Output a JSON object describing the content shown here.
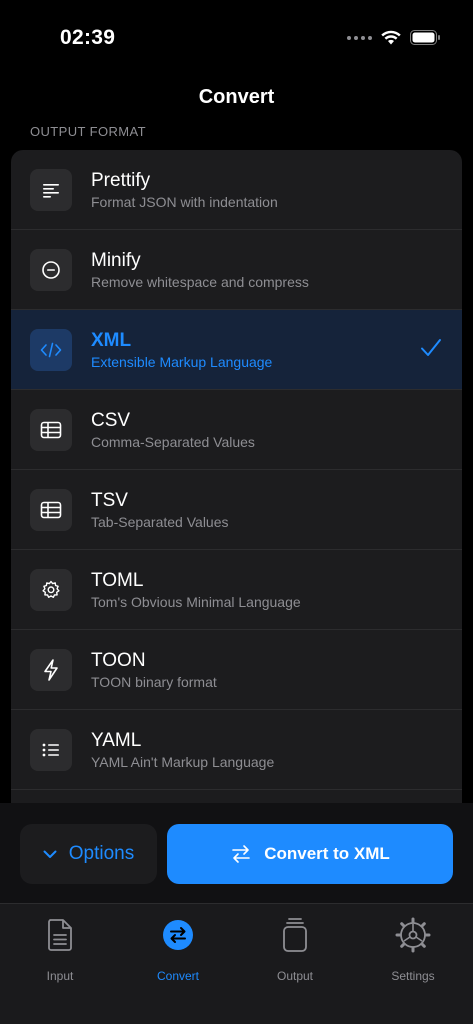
{
  "status_bar": {
    "time": "02:39"
  },
  "nav": {
    "title": "Convert"
  },
  "section": {
    "header": "OUTPUT FORMAT"
  },
  "formats": [
    {
      "title": "Prettify",
      "subtitle": "Format JSON with indentation",
      "icon": "text-align-left-icon",
      "selected": false
    },
    {
      "title": "Minify",
      "subtitle": "Remove whitespace and compress",
      "icon": "minus-circle-icon",
      "selected": false
    },
    {
      "title": "XML",
      "subtitle": "Extensible Markup Language",
      "icon": "code-brackets-icon",
      "selected": true
    },
    {
      "title": "CSV",
      "subtitle": "Comma-Separated Values",
      "icon": "table-icon",
      "selected": false
    },
    {
      "title": "TSV",
      "subtitle": "Tab-Separated Values",
      "icon": "table-icon",
      "selected": false
    },
    {
      "title": "TOML",
      "subtitle": "Tom's Obvious Minimal Language",
      "icon": "gear-icon",
      "selected": false
    },
    {
      "title": "TOON",
      "subtitle": "TOON binary format",
      "icon": "lightning-icon",
      "selected": false
    },
    {
      "title": "YAML",
      "subtitle": "YAML Ain't Markup Language",
      "icon": "list-icon",
      "selected": false
    }
  ],
  "actions": {
    "options_label": "Options",
    "convert_label": "Convert to XML"
  },
  "tabs": [
    {
      "label": "Input",
      "icon": "document-icon",
      "active": false
    },
    {
      "label": "Convert",
      "icon": "convert-arrows-icon",
      "active": true
    },
    {
      "label": "Output",
      "icon": "clipboard-stack-icon",
      "active": false
    },
    {
      "label": "Settings",
      "icon": "gear-icon",
      "active": false
    }
  ],
  "colors": {
    "accent": "#1e8bff",
    "background": "#000000",
    "card": "#1c1c1e",
    "selected_row": "#15233a",
    "secondary_text": "#8e8e93"
  }
}
